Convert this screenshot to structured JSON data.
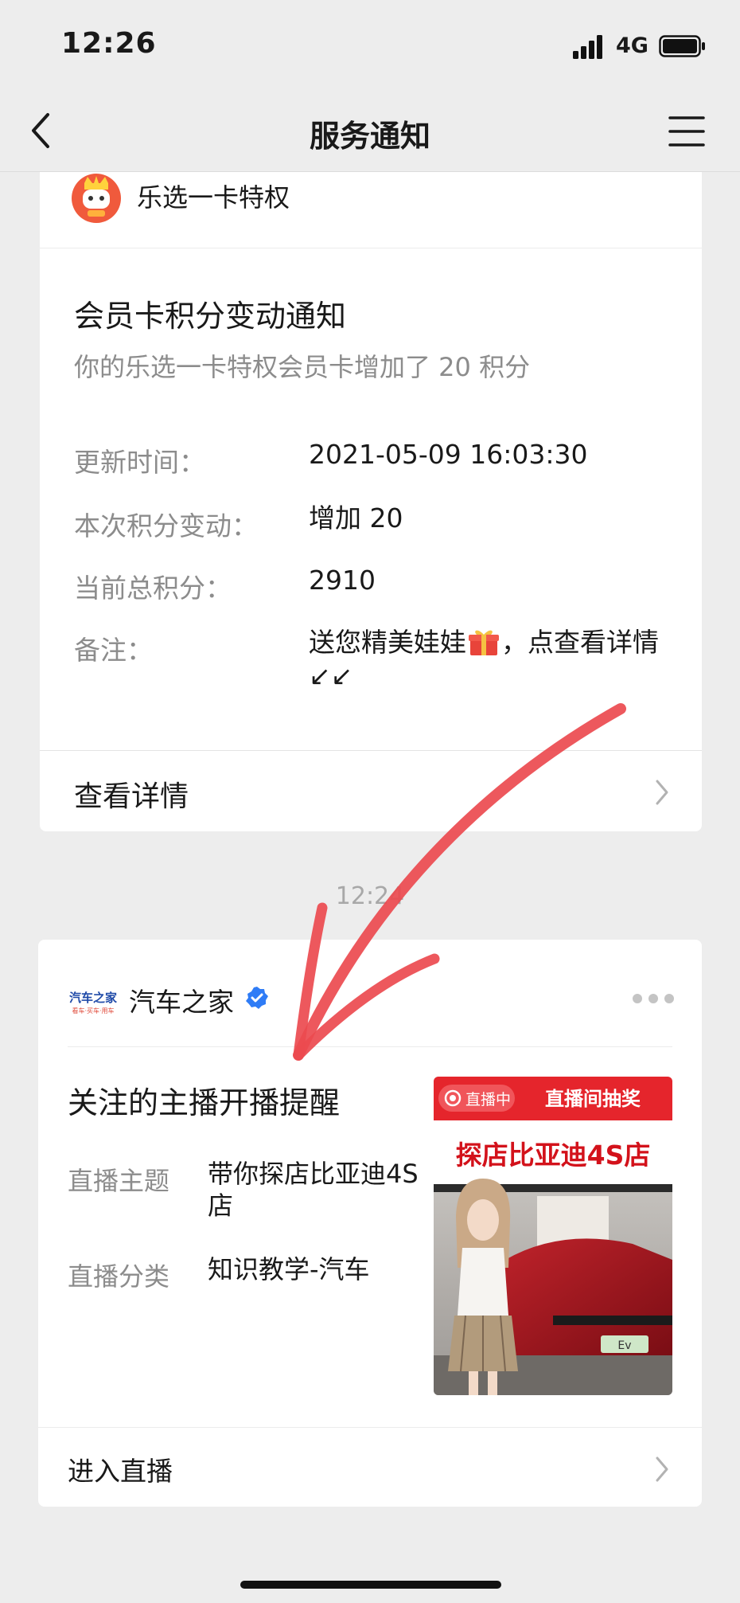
{
  "status_bar": {
    "time": "12:26",
    "network": "4G"
  },
  "nav": {
    "title": "服务通知"
  },
  "card1": {
    "brand": "乐选一卡特权",
    "title": "会员卡积分变动通知",
    "subtitle": "你的乐选一卡特权会员卡增加了 20 积分",
    "rows": [
      {
        "label": "更新时间：",
        "value": "2021-05-09 16:03:30"
      },
      {
        "label": "本次积分变动：",
        "value": "增加 20"
      },
      {
        "label": "当前总积分：",
        "value": "2910"
      },
      {
        "label": "备注：",
        "value_before": "送您精美娃娃",
        "value_after": "，点查看详情↙↙"
      }
    ],
    "footer_label": "查看详情"
  },
  "timestamp": "12:24",
  "card2": {
    "logo_text": "汽车之家",
    "logo_tagline": "看车·买车·用车",
    "brand": "汽车之家",
    "title": "关注的主播开播提醒",
    "rows": [
      {
        "label": "直播主题",
        "value": "带你探店比亚迪4S店"
      },
      {
        "label": "直播分类",
        "value": "知识教学-汽车"
      }
    ],
    "thumbnail": {
      "live_badge": "直播中",
      "banner": "直播间抽奖",
      "headline": "探店比亚迪4S店",
      "plate": "Ev"
    },
    "footer_label": "进入直播"
  },
  "colors": {
    "background": "#ededed",
    "card": "#ffffff",
    "secondary_text": "#8c8c8c",
    "verified_blue": "#2f7cf6",
    "annotation_arrow": "#ec4a4f",
    "live_red": "#e5252c"
  },
  "icons": [
    "signal-icon",
    "battery-icon",
    "back-icon",
    "menu-icon",
    "gift-icon",
    "chevron-right-icon",
    "verified-icon",
    "more-icon",
    "live-dot-icon"
  ]
}
